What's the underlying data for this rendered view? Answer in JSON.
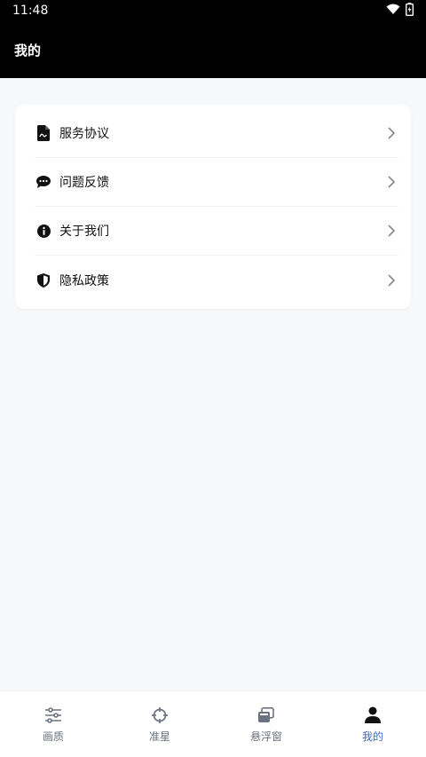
{
  "status_bar": {
    "time": "11:48",
    "wifi_icon": "wifi-icon",
    "battery_icon": "battery-charging-icon"
  },
  "app_bar": {
    "title": "我的"
  },
  "menu": {
    "items": [
      {
        "label": "服务协议",
        "icon": "document-icon"
      },
      {
        "label": "问题反馈",
        "icon": "chat-bubble-icon"
      },
      {
        "label": "关于我们",
        "icon": "info-icon"
      },
      {
        "label": "隐私政策",
        "icon": "shield-icon"
      }
    ]
  },
  "bottom_nav": {
    "items": [
      {
        "label": "画质",
        "icon": "sliders-icon"
      },
      {
        "label": "准星",
        "icon": "crosshair-icon"
      },
      {
        "label": "悬浮窗",
        "icon": "floating-window-icon"
      },
      {
        "label": "我的",
        "icon": "person-icon",
        "active": true
      }
    ],
    "active_color": "#3b6fc4",
    "inactive_color": "#6b7280"
  }
}
